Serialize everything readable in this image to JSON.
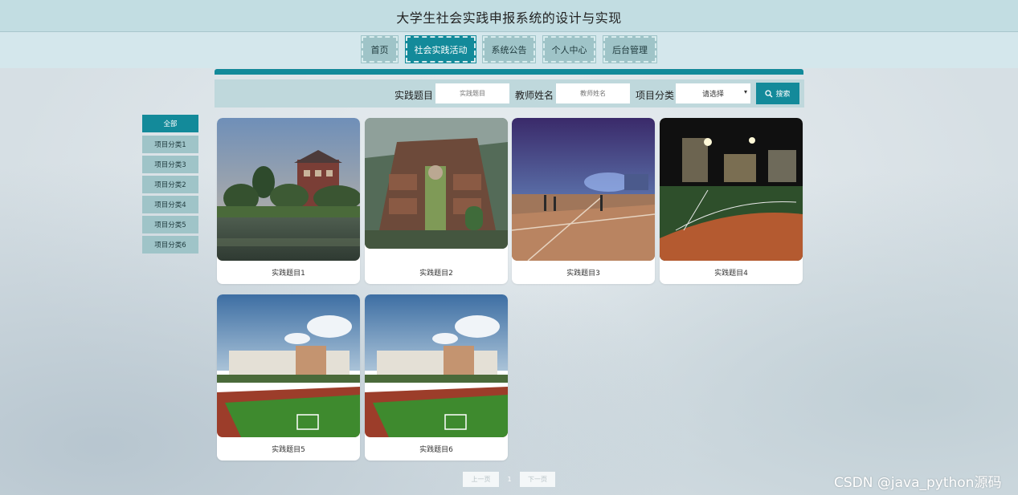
{
  "header": {
    "title": "大学生社会实践申报系统的设计与实现"
  },
  "nav": {
    "items": [
      {
        "label": "首页",
        "active": false
      },
      {
        "label": "社会实践活动",
        "active": true
      },
      {
        "label": "系统公告",
        "active": false
      },
      {
        "label": "个人中心",
        "active": false
      },
      {
        "label": "后台管理",
        "active": false
      }
    ]
  },
  "search": {
    "topic_label": "实践题目",
    "topic_placeholder": "实践题目",
    "teacher_label": "教师姓名",
    "teacher_placeholder": "教师姓名",
    "category_label": "项目分类",
    "category_selected": "请选择",
    "button_label": "搜索"
  },
  "sidebar": {
    "items": [
      {
        "label": "全部",
        "active": true
      },
      {
        "label": "项目分类1"
      },
      {
        "label": "项目分类3"
      },
      {
        "label": "项目分类2"
      },
      {
        "label": "项目分类4"
      },
      {
        "label": "项目分类5"
      },
      {
        "label": "项目分类6"
      }
    ]
  },
  "cards": [
    {
      "title": "实践题目1",
      "image": "lake-campus-building"
    },
    {
      "title": "实践题目2",
      "image": "campus-aerial-view"
    },
    {
      "title": "实践题目3",
      "image": "night-court"
    },
    {
      "title": "实践题目4",
      "image": "night-sports-field"
    },
    {
      "title": "实践题目5",
      "image": "school-football-field"
    },
    {
      "title": "实践题目6",
      "image": "school-football-field"
    }
  ],
  "pagination": {
    "prev_label": "上一页",
    "current": "1",
    "next_label": "下一页"
  },
  "watermark": "CSDN @java_python源码",
  "colors": {
    "accent": "#138a9a",
    "nav_bg": "#9fc4c8",
    "header_bg": "#c2dde2"
  }
}
